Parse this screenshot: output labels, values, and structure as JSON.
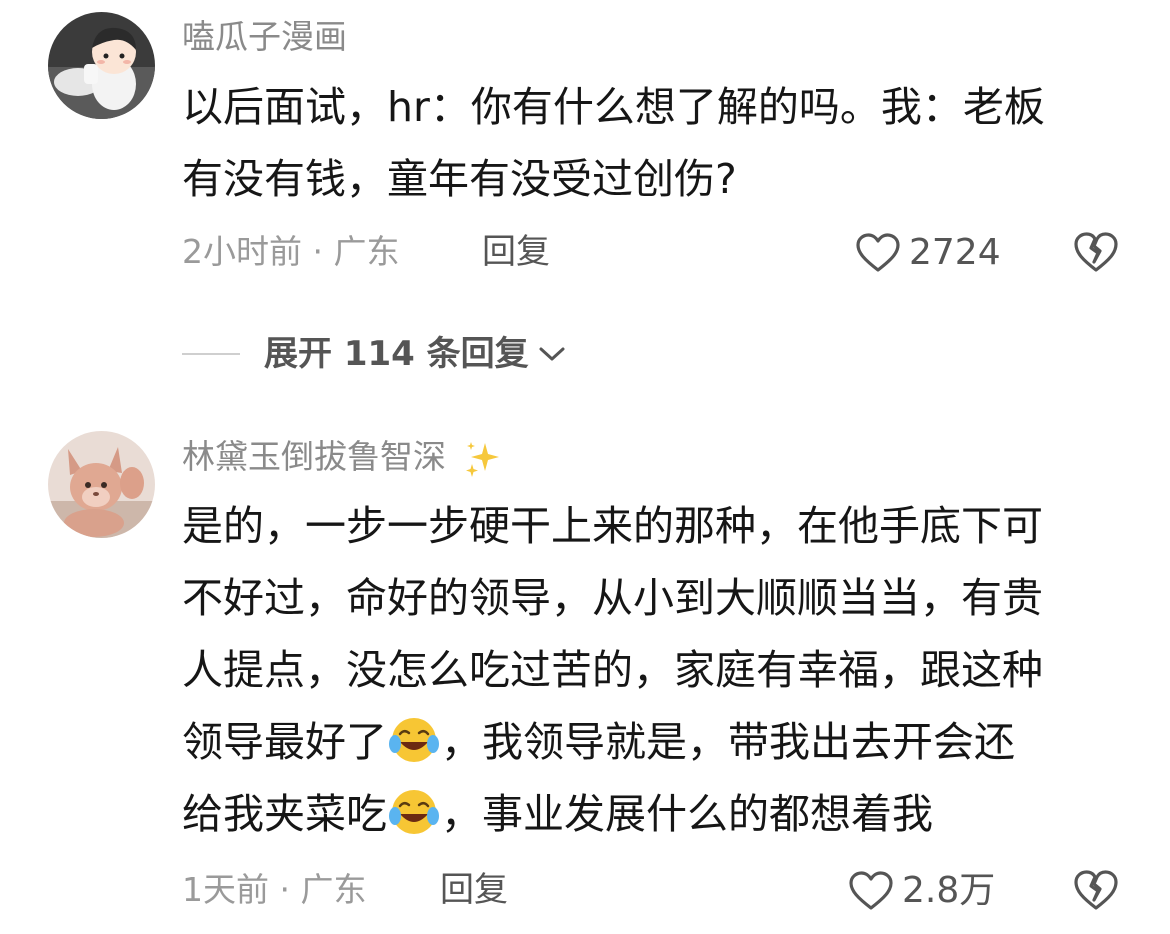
{
  "comments": [
    {
      "username": "嗑瓜子漫画",
      "lines": [
        "以后面试，hr：你有什么想了解的吗。我：老板",
        "有没有钱，童年有没受过创伤?"
      ],
      "time": "2小时前 · 广东",
      "reply_label": "回复",
      "likes": "2724",
      "avatar_icon": "cartoon-boy-avatar",
      "dislike_icon": "broken-heart-icon"
    },
    {
      "username": "林黛玉倒拔鲁智深",
      "username_emoji": "sparkles-icon",
      "lines": [
        "是的，一步一步硬干上来的那种，在他手底下可",
        "不好过，命好的领导，从小到大顺顺当当，有贵",
        "人提点，没怎么吃过苦的，家庭有幸福，跟这种"
      ],
      "line4_a": "领导最好了",
      "line4_b": "，我领导就是，带我出去开会还",
      "line5_a": "给我夹菜吃",
      "line5_b": "，事业发展什么的都想着我",
      "inline_emoji": "laughing-tears-emoji",
      "time": "1天前 · 广东",
      "reply_label": "回复",
      "likes": "2.8万",
      "avatar_icon": "plush-toy-avatar",
      "dislike_icon": "broken-heart-icon"
    }
  ],
  "expand_replies": {
    "label": "展开 114 条回复"
  },
  "colors": {
    "text": "#161616",
    "muted": "#9a9a9a",
    "username": "#8a8a8a",
    "action": "#555555"
  }
}
